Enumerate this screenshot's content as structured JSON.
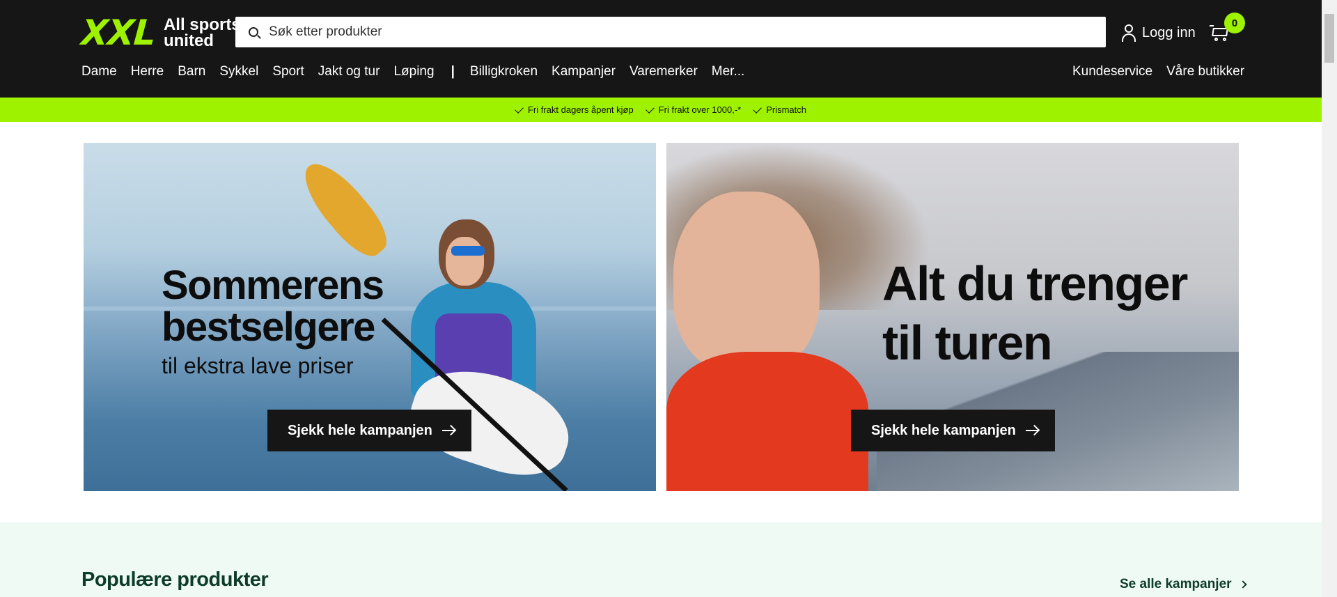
{
  "header": {
    "logo_mark": "XXL",
    "logo_tagline_line1": "All sports",
    "logo_tagline_line2": "united",
    "search_placeholder": "Søk etter produkter",
    "login_label": "Logg inn",
    "cart_count": "0"
  },
  "nav": {
    "items": [
      "Dame",
      "Herre",
      "Barn",
      "Sykkel",
      "Sport",
      "Jakt og tur",
      "Løping"
    ],
    "separator": "|",
    "items2": [
      "Billigkroken",
      "Kampanjer",
      "Varemerker",
      "Mer..."
    ],
    "right": [
      "Kundeservice",
      "Våre butikker"
    ]
  },
  "usp": [
    "Fri frakt dagers åpent kjøp",
    "Fri frakt over 1000,-*",
    "Prismatch"
  ],
  "banners": {
    "left": {
      "title_line1": "Sommerens",
      "title_line2": "bestselgere",
      "subtitle": "til ekstra lave priser",
      "cta": "Sjekk hele kampanjen"
    },
    "right": {
      "title_line1": "Alt du trenger",
      "title_line2": "til turen",
      "cta": "Sjekk hele kampanjen"
    }
  },
  "popular": {
    "title": "Populære produkter",
    "see_all": "Se alle kampanjer"
  },
  "colors": {
    "brand_green": "#9ef200",
    "header_bg": "#161616",
    "section_text": "#0d3b2c"
  }
}
